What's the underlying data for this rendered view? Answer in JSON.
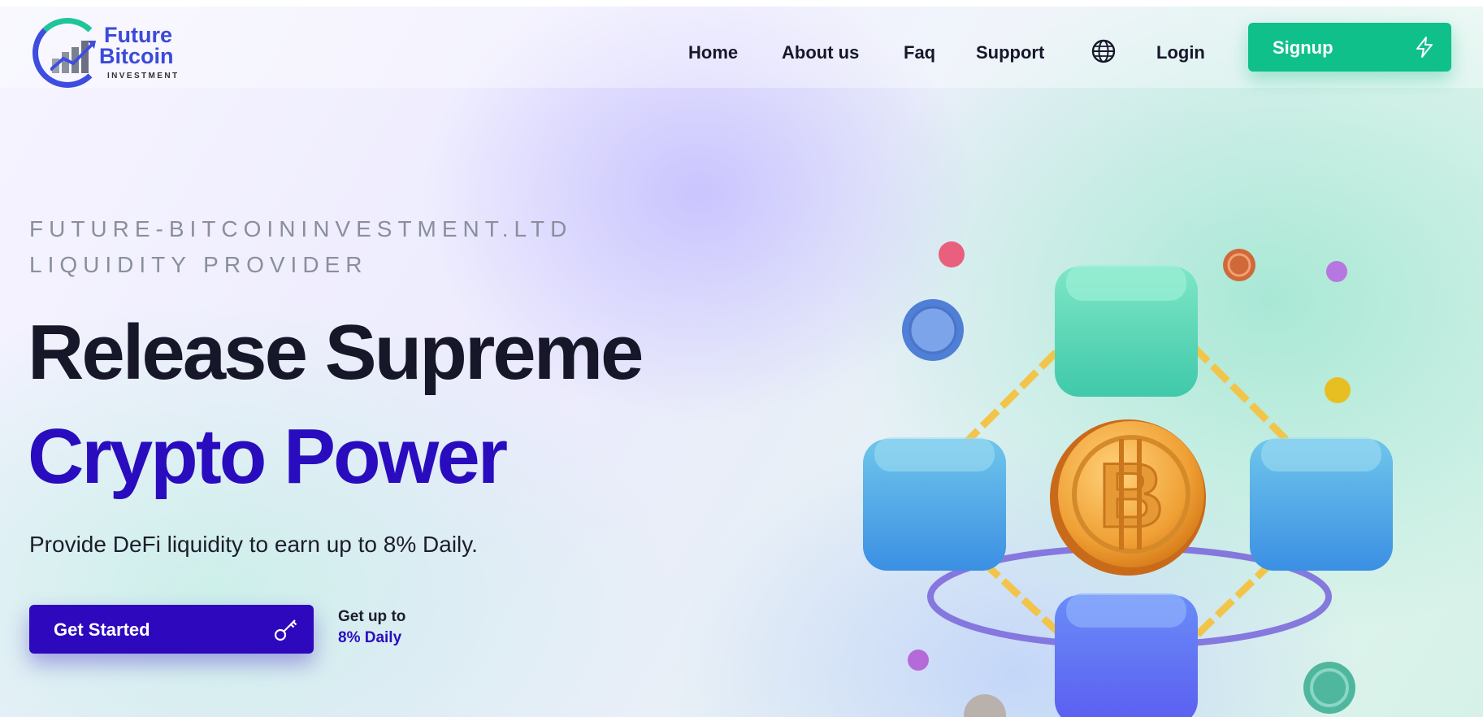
{
  "header": {
    "logo": {
      "line1": "Future",
      "line2": "Bitcoin",
      "line3": "INVESTMENT",
      "icon": "rising-bars-chart-logo"
    },
    "nav": [
      {
        "label": "Home"
      },
      {
        "label": "About us"
      },
      {
        "label": "Faq"
      },
      {
        "label": "Support"
      }
    ],
    "language_icon": "globe-icon",
    "login_label": "Login",
    "signup": {
      "label": "Signup",
      "icon": "lightning-bolt-icon"
    }
  },
  "hero": {
    "eyebrow_line1": "FUTURE-BITCOININVESTMENT.LTD",
    "eyebrow_line2": "LIQUIDITY PROVIDER",
    "headline_line1": "Release Supreme",
    "headline_line2": "Crypto Power",
    "subtitle": "Provide DeFi liquidity to earn up to 8% Daily.",
    "cta": {
      "label": "Get Started",
      "icon": "key-icon"
    },
    "note_line1": "Get up to",
    "note_line2": "8% Daily",
    "illustration": "bitcoin-coin-chained-to-four-cubes-illustration"
  },
  "colors": {
    "signup_green": "#0fc08a",
    "cta_purple": "#2d08bd",
    "accent_purple": "#2a0cbf",
    "logo_blue": "#3b4ad8",
    "text_dark": "#17172a",
    "eyebrow_gray": "#8a8f9c"
  }
}
